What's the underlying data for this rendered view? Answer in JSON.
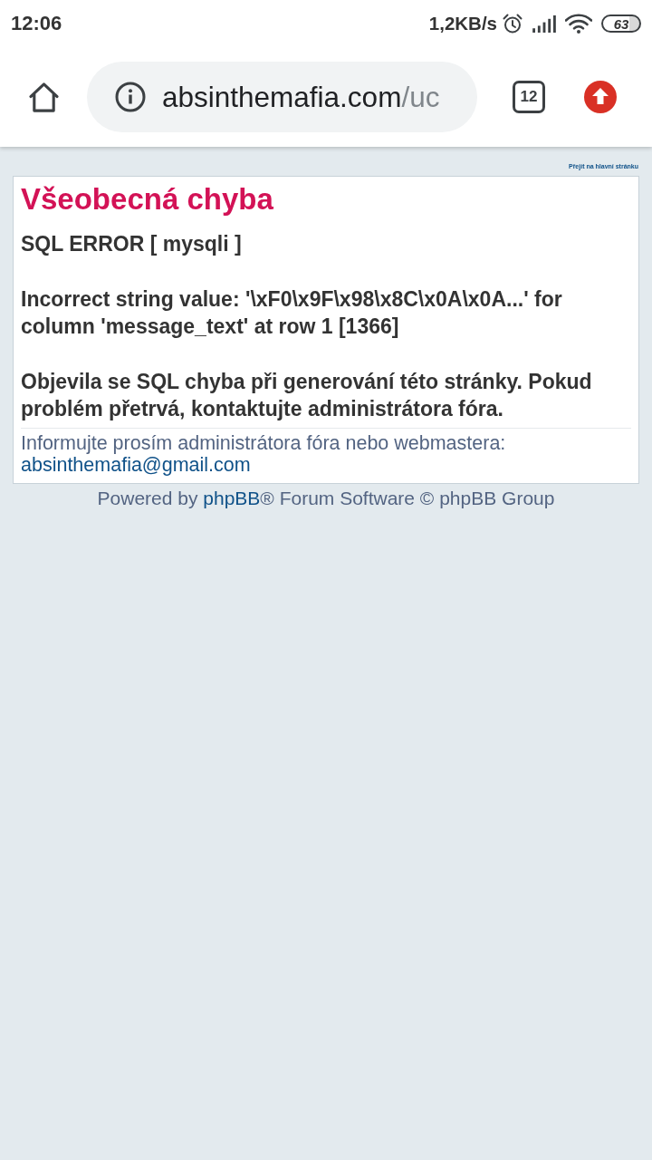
{
  "status_bar": {
    "time": "12:06",
    "net_speed": "1,2KB/s",
    "battery": "63"
  },
  "browser": {
    "url_domain": "absinthemafia.com",
    "url_path": "/uc",
    "tab_count": "12"
  },
  "page": {
    "top_link": "Přejít na hlavní stránku",
    "title": "Všeobecná chyba",
    "error_heading": "SQL ERROR [ mysqli ]",
    "error_message": "Incorrect string value: '\\xF0\\x9F\\x98\\x8C\\x0A\\x0A...' for column 'message_text' at row 1 [1366]",
    "explanation": "Objevila se SQL chyba při generování této stránky. Pokud problém přetrvá, kontaktujte administrátora fóra.",
    "contact_text": "Informujte prosím administrátora fóra nebo webmastera:",
    "contact_email": "absinthemafia@gmail.com"
  },
  "footer": {
    "prefix": "Powered by",
    "link": "phpBB",
    "suffix": "® Forum Software © phpBB Group"
  }
}
